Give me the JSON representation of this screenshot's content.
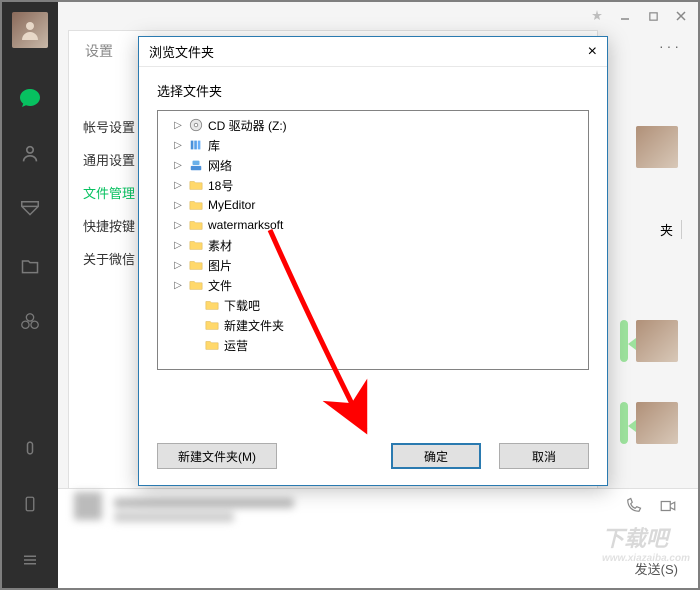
{
  "sidebar": {
    "icons": [
      "chat",
      "contacts",
      "favorites",
      "files",
      "moments"
    ],
    "bottom_icons": [
      "miniprogram",
      "phone",
      "menu"
    ]
  },
  "topbar": {
    "icons": [
      "pin",
      "minimize",
      "maximize",
      "close"
    ]
  },
  "more": "···",
  "settings": {
    "title": "设置",
    "close": "×",
    "nav": [
      "帐号设置",
      "通用设置",
      "文件管理",
      "快捷按键",
      "关于微信"
    ]
  },
  "jia_fragment": "夹",
  "dialog": {
    "title": "浏览文件夹",
    "close": "×",
    "subtitle": "选择文件夹",
    "tree": [
      {
        "indent": 0,
        "expander": "▷",
        "icon": "cd",
        "label": "CD 驱动器 (Z:)"
      },
      {
        "indent": 0,
        "expander": "▷",
        "icon": "lib",
        "label": "库"
      },
      {
        "indent": 0,
        "expander": "▷",
        "icon": "net",
        "label": "网络"
      },
      {
        "indent": 0,
        "expander": "▷",
        "icon": "folder",
        "label": "18号"
      },
      {
        "indent": 0,
        "expander": "▷",
        "icon": "folder",
        "label": "MyEditor"
      },
      {
        "indent": 0,
        "expander": "▷",
        "icon": "folder",
        "label": "watermarksoft"
      },
      {
        "indent": 0,
        "expander": "▷",
        "icon": "folder",
        "label": "素材"
      },
      {
        "indent": 0,
        "expander": "▷",
        "icon": "folder",
        "label": "图片"
      },
      {
        "indent": 0,
        "expander": "▷",
        "icon": "folder",
        "label": "文件"
      },
      {
        "indent": 1,
        "expander": "",
        "icon": "folder",
        "label": "下载吧"
      },
      {
        "indent": 1,
        "expander": "",
        "icon": "folder",
        "label": "新建文件夹"
      },
      {
        "indent": 1,
        "expander": "",
        "icon": "folder",
        "label": "运营"
      }
    ],
    "buttons": {
      "new_folder": "新建文件夹(M)",
      "ok": "确定",
      "cancel": "取消"
    }
  },
  "send_label": "发送(S)",
  "watermark": {
    "main": "下载吧",
    "sub": "www.xiazaiba.com"
  }
}
